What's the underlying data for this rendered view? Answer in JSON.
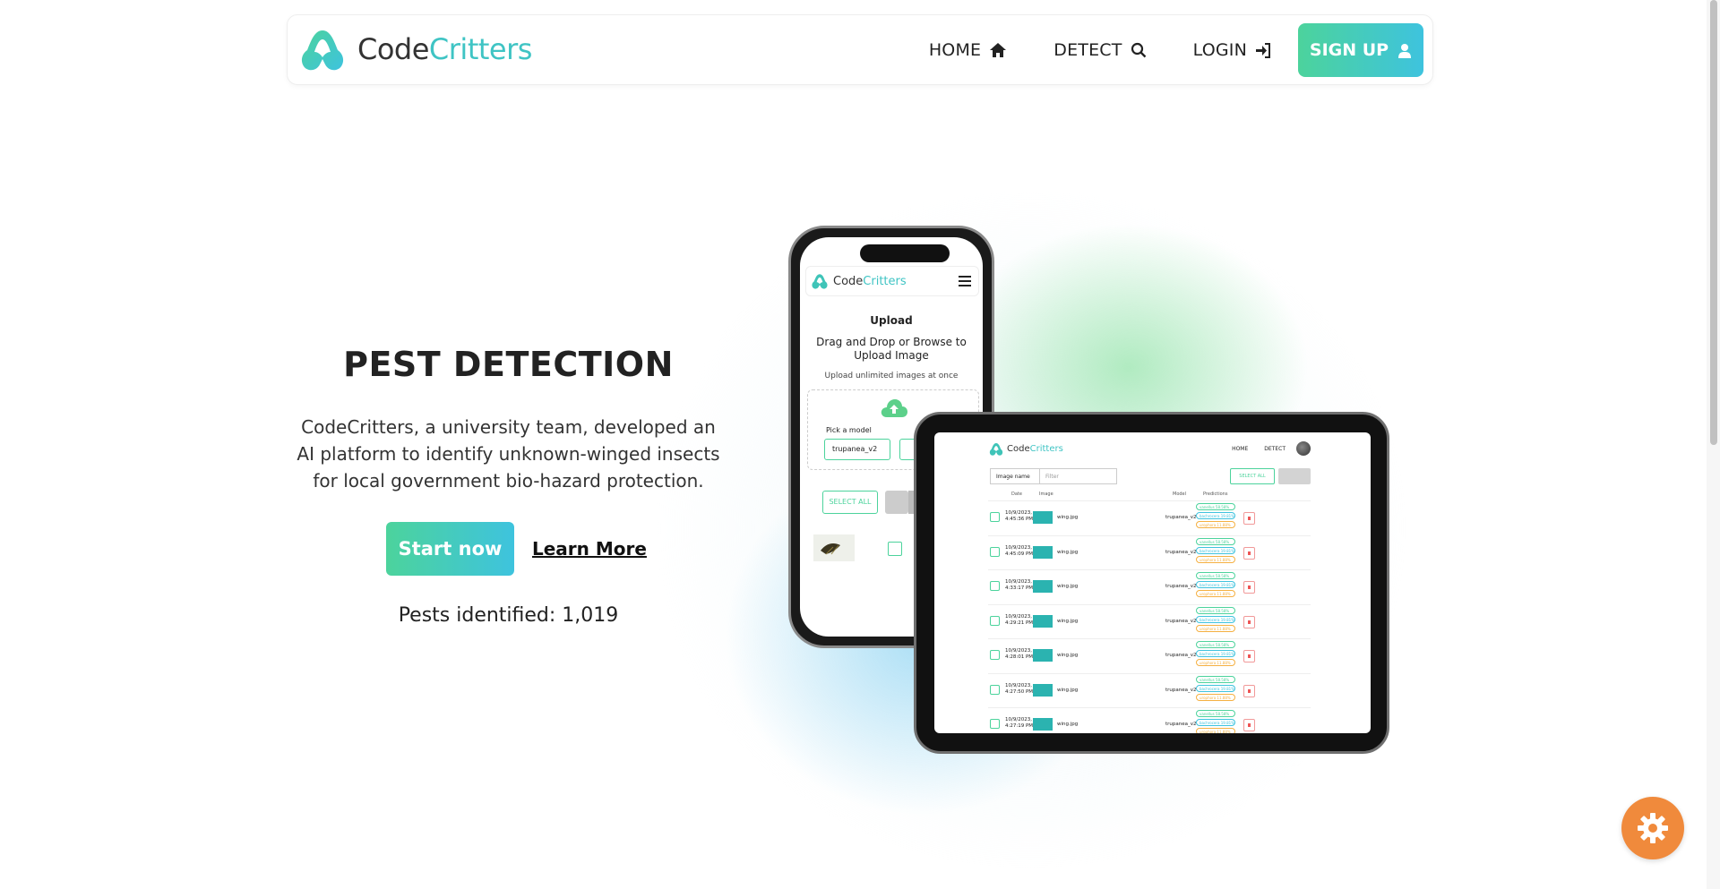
{
  "brand": {
    "name_part1": "Code",
    "name_part2": "Critters"
  },
  "nav": {
    "home": "HOME",
    "detect": "DETECT",
    "login": "LOGIN",
    "signup": "SIGN UP"
  },
  "hero": {
    "title": "PEST DETECTION",
    "description": "CodeCritters, a university team, developed an AI platform to identify unknown-winged insects for local government bio-hazard protection.",
    "start_button": "Start now",
    "learn_more": "Learn More",
    "pest_count": "Pests identified: 1,019"
  },
  "phone_mockup": {
    "brand1": "Code",
    "brand2": "Critters",
    "upload_title": "Upload",
    "drag_text": "Drag and Drop or Browse to Upload Image",
    "unlimited_text": "Upload unlimited images at once",
    "pick_model": "Pick a model",
    "model_value": "trupanea_v2",
    "select_all": "SELECT ALL"
  },
  "tablet_mockup": {
    "brand1": "Code",
    "brand2": "Critters",
    "nav_home": "HOME",
    "nav_detect": "DETECT",
    "filter_dropdown": "Image name",
    "filter_placeholder": "Filter",
    "select_all": "SELECT ALL",
    "headers": {
      "date": "Date",
      "image": "Image",
      "model": "Model",
      "predictions": "Predictions"
    },
    "rows": [
      {
        "date": "10/9/2023,",
        "time": "4:45:36 PM",
        "file": "wing.jpg",
        "model": "trupanea_v2"
      },
      {
        "date": "10/9/2023,",
        "time": "4:45:09 PM",
        "file": "wing.jpg",
        "model": "trupanea_v2"
      },
      {
        "date": "10/9/2023,",
        "time": "4:33:17 PM",
        "file": "wing.jpg",
        "model": "trupanea_v2"
      },
      {
        "date": "10/9/2023,",
        "time": "4:29:21 PM",
        "file": "wing.jpg",
        "model": "trupanea_v2"
      },
      {
        "date": "10/9/2023,",
        "time": "4:28:01 PM",
        "file": "wing.jpg",
        "model": "trupanea_v2"
      },
      {
        "date": "10/9/2023,",
        "time": "4:27:50 PM",
        "file": "wing.jpg",
        "model": "trupanea_v2"
      },
      {
        "date": "10/9/2023,",
        "time": "4:27:19 PM",
        "file": "wing.jpg",
        "model": "trupanea_v2"
      }
    ],
    "predictions": {
      "p1": "vanellus 58.58%",
      "p2": "bachrocera 19.81%",
      "p3": "urophora 11.88%"
    }
  },
  "icons": {
    "home": "home-icon",
    "detect": "search-icon",
    "login": "login-icon",
    "signup": "user-icon",
    "settings": "gear-icon"
  },
  "colors": {
    "accent_green": "#4cd39c",
    "accent_blue": "#3ec3de",
    "settings_orange": "#f08a3c"
  }
}
